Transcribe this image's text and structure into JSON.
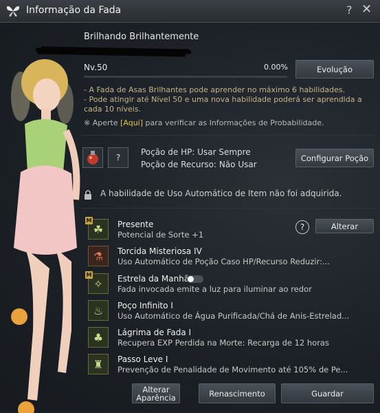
{
  "window": {
    "title": "Informação da Fada",
    "help": "?",
    "close": "✕"
  },
  "fairy": {
    "name": "Brilhando Brilhantemente",
    "level": "Nv.50",
    "exp_percent": "0.00%",
    "exp_progress": 0.0,
    "evolve_label": "Evolução"
  },
  "info": {
    "line1": "- A Fada de Asas Brilhantes pode aprender no máximo 6 habilidades.",
    "line2a": "- Pode atingir até Nível 50 e uma nova habilidade poderá ser aprendida a",
    "line2b": "cada 10 níveis.",
    "prob_prefix": "※ Aperte ",
    "prob_link": "[Aqui]",
    "prob_suffix": " para verificar as Informações de Probabilidade."
  },
  "potions": {
    "slot2": "?",
    "hp": "Poção de HP: Usar Sempre",
    "resource": "Poção de Recurso: Não Usar",
    "configure_label": "Configurar Poção"
  },
  "auto_use": {
    "text": "A habilidade de Uso Automático de Item não foi adquirida."
  },
  "skills": [
    {
      "badge": "M",
      "name": "Presente",
      "desc": "Potencial de Sorte +1"
    },
    {
      "badge": "",
      "name": "Torcida Misteriosa IV",
      "desc": "Uso Automático de Poção Caso HP/Recurso Reduzir:..."
    },
    {
      "badge": "M",
      "name": "Estrela da Manhã",
      "desc": "Fada invocada emite a luz para iluminar ao redor"
    },
    {
      "badge": "",
      "name": "Poço Infinito I",
      "desc": "Uso Automático de Água Purificada/Chá de Anis-Estrelad..."
    },
    {
      "badge": "",
      "name": "Lágrima de Fada I",
      "desc": "Recupera EXP Perdida na Morte: Recarga de 12 horas"
    },
    {
      "badge": "",
      "name": "Passo Leve I",
      "desc": "Prevenção de Penalidade de Movimento até 105% de Pe..."
    }
  ],
  "skill_help": "?",
  "change_label": "Alterar",
  "footer": {
    "appearance_line1": "Alterar",
    "appearance_line2": "Aparência",
    "rebirth": "Renascimento",
    "save": "Guardar"
  },
  "colors": {
    "accent_gold": "#caa142",
    "info_text": "#c6b48a",
    "link": "#e3c350"
  }
}
